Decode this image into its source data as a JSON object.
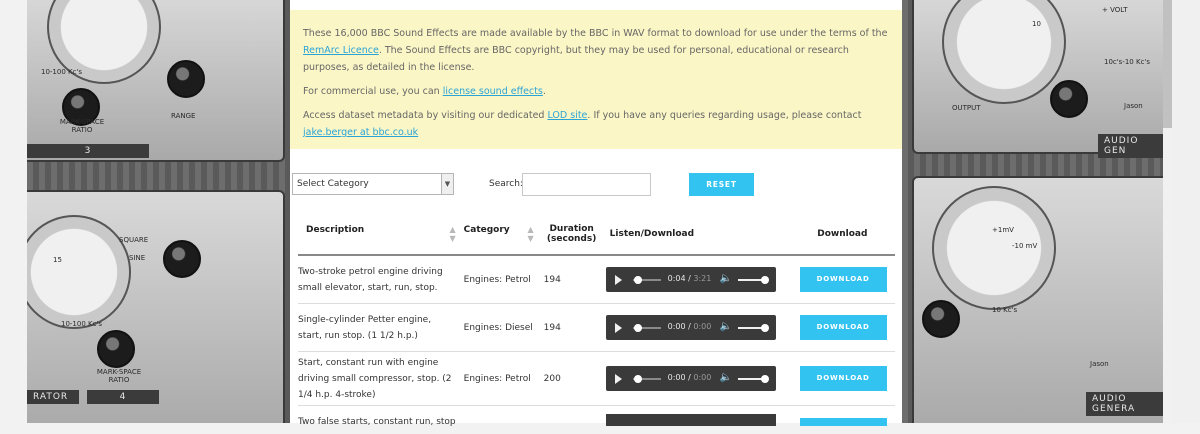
{
  "notice": {
    "p1_before": "These 16,000 BBC Sound Effects are made available by the BBC in WAV format to download for use under the terms of the ",
    "p1_link": "RemArc Licence",
    "p1_after": ". The Sound Effects are BBC copyright, but they may be used for personal, educational or research purposes, as detailed in the license.",
    "p2_before": "For commercial use, you can ",
    "p2_link": "license sound effects",
    "p2_after": ".",
    "p3_before": "Access dataset metadata by visiting our dedicated ",
    "p3_link": "LOD site",
    "p3_mid": ". If you have any queries regarding usage, please contact ",
    "p3_link2": "jake.berger at bbc.co.uk"
  },
  "controls": {
    "category_selected": "Select Category",
    "search_label": "Search:",
    "search_value": "",
    "reset_label": "RESET"
  },
  "table": {
    "headers": {
      "description": "Description",
      "category": "Category",
      "duration_line1": "Duration",
      "duration_line2": "(seconds)",
      "listen": "Listen/Download",
      "download": "Download"
    },
    "rows": [
      {
        "description": "Two-stroke petrol engine driving small elevator, start, run, stop.",
        "category": "Engines: Petrol",
        "duration": "194",
        "current_time": "0:04",
        "total_time": "3:21",
        "download_label": "DOWNLOAD"
      },
      {
        "description": "Single-cylinder Petter engine, start, run stop. (1 1/2 h.p.)",
        "category": "Engines: Diesel",
        "duration": "194",
        "current_time": "0:00",
        "total_time": "0:00",
        "download_label": "DOWNLOAD"
      },
      {
        "description": "Start, constant run with engine driving small compressor, stop. (2 1/4 h.p. 4-stroke)",
        "category": "Engines: Petrol",
        "duration": "200",
        "current_time": "0:00",
        "total_time": "0:00",
        "download_label": "DOWNLOAD"
      },
      {
        "description": "Two false starts, constant run, stop"
      }
    ]
  },
  "backdrop": {
    "left_labels": [
      "10-100 Kc's",
      "MARK-SPACE RATIO",
      "RANGE",
      "3",
      "SQUARE",
      "SINE",
      "15",
      "10-100 Kc's",
      "MARK-SPACE RATIO",
      "RATOR",
      "4"
    ],
    "right_labels": [
      "+ VOLT",
      "10",
      "10c's-10 Kc's",
      "OUTPUT",
      "Jason",
      "AUDIO GEN",
      "+1mV",
      "-10 mV",
      "10 Kc's",
      "Jason",
      "AUDIO GENERA"
    ]
  },
  "colors": {
    "accent": "#33c3f0",
    "link": "#2aa3d6",
    "notice_bg": "#fbf6c6",
    "player_bg": "#3a3a3a"
  }
}
